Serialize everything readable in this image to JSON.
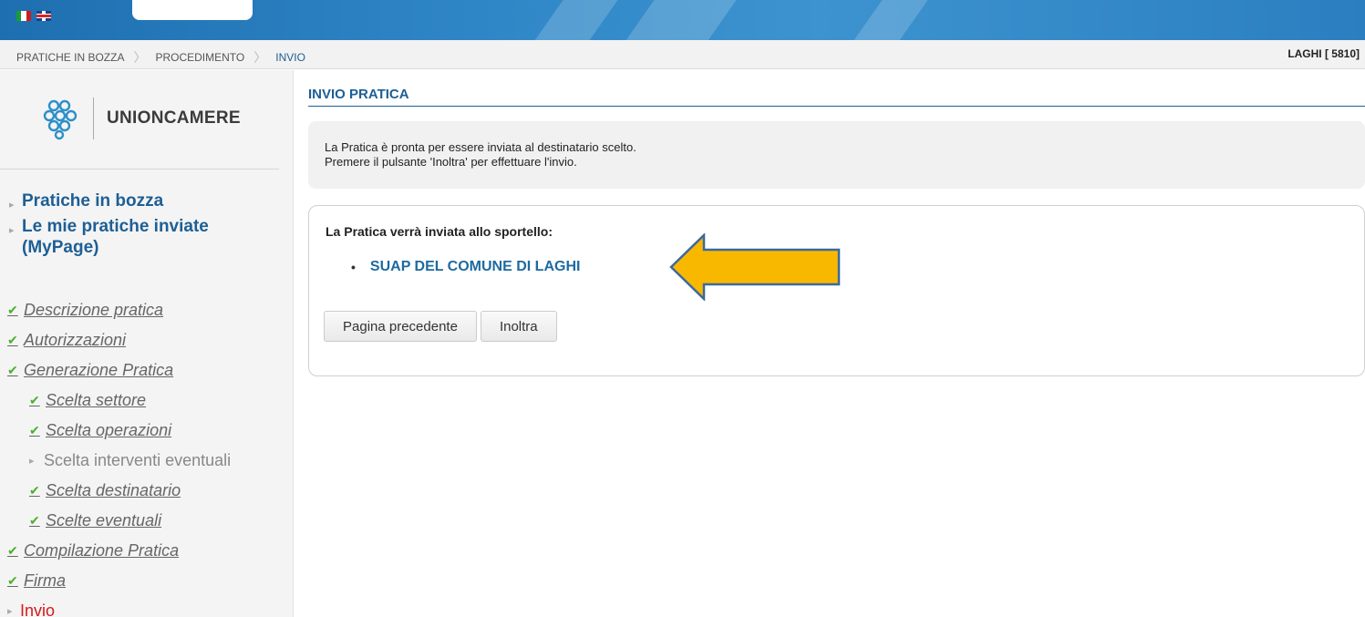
{
  "header": {
    "languages": [
      "it-flag-icon",
      "uk-flag-icon"
    ],
    "colors": {
      "banner": "#2f86c6",
      "link": "#1d5f95",
      "check": "#4caf32",
      "current": "#d31a1a",
      "arrow": "#f9b800"
    }
  },
  "breadcrumb": {
    "items": [
      "PRATICHE IN BOZZA",
      "PROCEDIMENTO",
      "INVIO"
    ],
    "user": "LAGHI [ 5810]"
  },
  "sidebar": {
    "brand": "UNIONCAMERE",
    "links": [
      {
        "label": "Pratiche in bozza"
      },
      {
        "label": "Le mie pratiche inviate (MyPage)"
      }
    ],
    "steps": [
      {
        "label": "Descrizione pratica",
        "state": "done"
      },
      {
        "label": "Autorizzazioni",
        "state": "done"
      },
      {
        "label": "Generazione Pratica",
        "state": "done"
      },
      {
        "label": "Scelta settore",
        "state": "done"
      },
      {
        "label": "Scelta operazioni",
        "state": "done"
      },
      {
        "label": "Scelta interventi eventuali",
        "state": "pending"
      },
      {
        "label": "Scelta destinatario",
        "state": "done"
      },
      {
        "label": "Scelte eventuali",
        "state": "done"
      },
      {
        "label": "Compilazione Pratica",
        "state": "done"
      },
      {
        "label": "Firma",
        "state": "done"
      },
      {
        "label": "Invio",
        "state": "current"
      }
    ]
  },
  "main": {
    "title": "INVIO PRATICA",
    "info_line1": "La Pratica è pronta per essere inviata al destinatario scelto.",
    "info_line2": "Premere il pulsante 'Inoltra' per effettuare l'invio.",
    "panel_heading": "La Pratica verrà inviata allo sportello:",
    "destination": "SUAP DEL COMUNE DI LAGHI",
    "buttons": {
      "previous": "Pagina precedente",
      "forward": "Inoltra"
    }
  }
}
